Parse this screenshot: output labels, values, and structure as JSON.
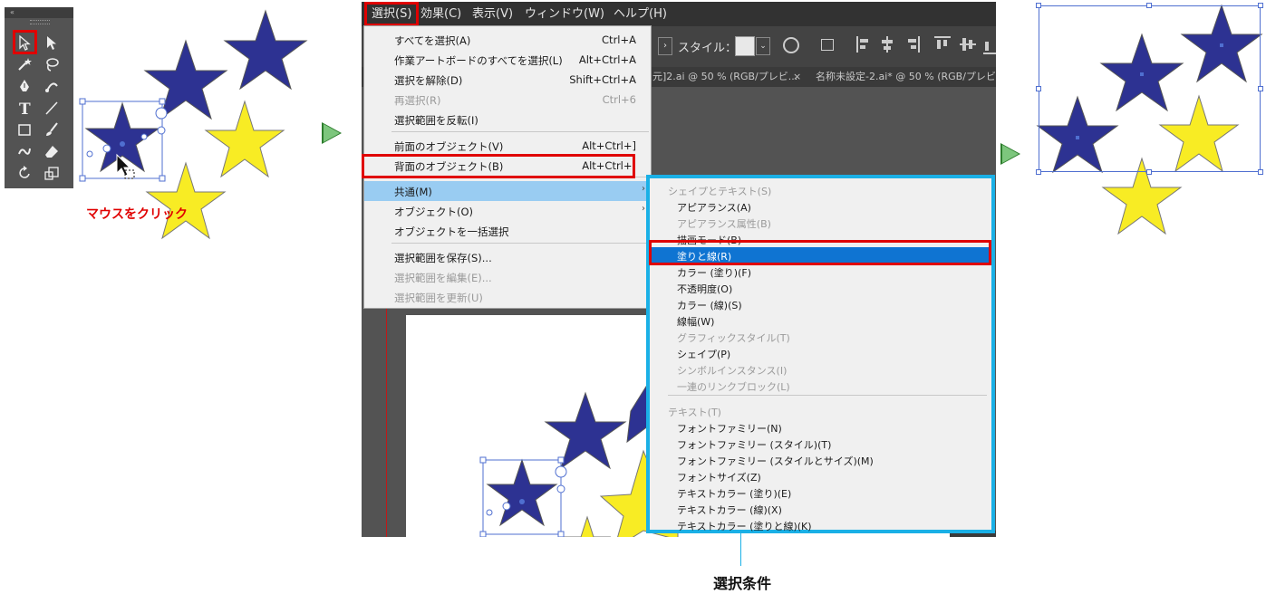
{
  "toolbox": {
    "grip_label": "«",
    "highlight_color": "#e00000",
    "tools": [
      {
        "name": "selection-tool-icon",
        "glyph": "selection"
      },
      {
        "name": "direct-selection-tool-icon",
        "glyph": "direct"
      },
      {
        "name": "magic-wand-tool-icon",
        "glyph": "wand"
      },
      {
        "name": "lasso-tool-icon",
        "glyph": "lasso"
      },
      {
        "name": "pen-tool-icon",
        "glyph": "pen"
      },
      {
        "name": "curvature-tool-icon",
        "glyph": "curvature"
      },
      {
        "name": "type-tool-icon",
        "glyph": "type"
      },
      {
        "name": "line-tool-icon",
        "glyph": "line"
      },
      {
        "name": "rectangle-tool-icon",
        "glyph": "rect"
      },
      {
        "name": "paintbrush-tool-icon",
        "glyph": "brush"
      },
      {
        "name": "shaper-tool-icon",
        "glyph": "shaper"
      },
      {
        "name": "eraser-tool-icon",
        "glyph": "eraser"
      },
      {
        "name": "rotate-tool-icon",
        "glyph": "rotate"
      },
      {
        "name": "scale-tool-icon",
        "glyph": "scale"
      }
    ]
  },
  "left_panel": {
    "click_label": "マウスをクリック"
  },
  "colors": {
    "star_blue": "#2d3292",
    "star_yellow": "#f8ec24",
    "selection_blue": "#4f6fd0",
    "menu_highlight": "#99ccf2",
    "submenu_border": "#1ab0e6",
    "submenu_selected": "#0f74d2"
  },
  "menubar": {
    "items": [
      "選択(S)",
      "効果(C)",
      "表示(V)",
      "ウィンドウ(W)",
      "ヘルプ(H)"
    ]
  },
  "toolbar": {
    "style_label": "スタイル："
  },
  "tabs": {
    "tab1": "元]2.ai @ 50 % (RGB/プレビ...",
    "tab2": "名称未設定-2.ai* @ 50 % (RGB/プレビュー",
    "close": "×"
  },
  "select_menu": {
    "items": [
      {
        "label": "すべてを選択(A)",
        "shortcut": "Ctrl+A",
        "disabled": false
      },
      {
        "label": "作業アートボードのすべてを選択(L)",
        "shortcut": "Alt+Ctrl+A",
        "disabled": false
      },
      {
        "label": "選択を解除(D)",
        "shortcut": "Shift+Ctrl+A",
        "disabled": false
      },
      {
        "label": "再選択(R)",
        "shortcut": "Ctrl+6",
        "disabled": true
      },
      {
        "label": "選択範囲を反転(I)",
        "shortcut": "",
        "disabled": false
      },
      {
        "label": "前面のオブジェクト(V)",
        "shortcut": "Alt+Ctrl+]",
        "disabled": false
      },
      {
        "label": "背面のオブジェクト(B)",
        "shortcut": "Alt+Ctrl+[",
        "disabled": false
      },
      {
        "label": "共通(M)",
        "shortcut": "",
        "disabled": false
      },
      {
        "label": "オブジェクト(O)",
        "shortcut": "",
        "disabled": false
      },
      {
        "label": "オブジェクトを一括選択",
        "shortcut": "",
        "disabled": false
      },
      {
        "label": "選択範囲を保存(S)...",
        "shortcut": "",
        "disabled": false
      },
      {
        "label": "選択範囲を編集(E)...",
        "shortcut": "",
        "disabled": true
      },
      {
        "label": "選択範囲を更新(U)",
        "shortcut": "",
        "disabled": true
      }
    ],
    "submenu_caret": "›"
  },
  "common_submenu": {
    "shape_text_header": "シェイプとテキスト(S)",
    "shape_items": [
      {
        "label": "アピアランス(A)",
        "disabled": false
      },
      {
        "label": "アピアランス属性(B)",
        "disabled": true
      },
      {
        "label": "描画モード(B)",
        "disabled": false
      },
      {
        "label": "塗りと線(R)",
        "disabled": false
      },
      {
        "label": "カラー (塗り)(F)",
        "disabled": false
      },
      {
        "label": "不透明度(O)",
        "disabled": false
      },
      {
        "label": "カラー (線)(S)",
        "disabled": false
      },
      {
        "label": "線幅(W)",
        "disabled": false
      },
      {
        "label": "グラフィックスタイル(T)",
        "disabled": true
      },
      {
        "label": "シェイプ(P)",
        "disabled": false
      },
      {
        "label": "シンボルインスタンス(I)",
        "disabled": true
      },
      {
        "label": "一連のリンクブロック(L)",
        "disabled": true
      }
    ],
    "text_header": "テキスト(T)",
    "text_items": [
      {
        "label": "フォントファミリー(N)",
        "disabled": false
      },
      {
        "label": "フォントファミリー (スタイル)(T)",
        "disabled": false
      },
      {
        "label": "フォントファミリー (スタイルとサイズ)(M)",
        "disabled": false
      },
      {
        "label": "フォントサイズ(Z)",
        "disabled": false
      },
      {
        "label": "テキストカラー (塗り)(E)",
        "disabled": false
      },
      {
        "label": "テキストカラー (線)(X)",
        "disabled": false
      },
      {
        "label": "テキストカラー (塗りと線)(K)",
        "disabled": false
      }
    ]
  },
  "callout": {
    "label": "選択条件"
  }
}
